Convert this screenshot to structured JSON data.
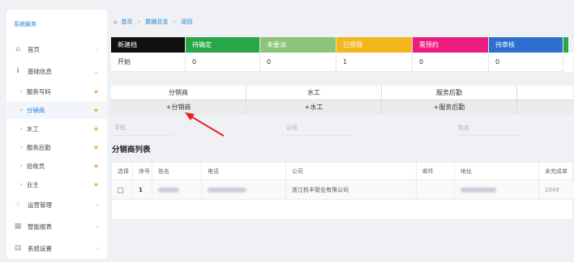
{
  "sidebar": {
    "title": "系统服务",
    "items": [
      {
        "icon": "home-icon",
        "label": "首页"
      },
      {
        "icon": "info-icon",
        "label": "基础信息"
      },
      {
        "icon": "hand-icon",
        "label": "运营管理"
      },
      {
        "icon": "table-icon",
        "label": "智能报表"
      },
      {
        "icon": "settings-icon",
        "label": "系统设置"
      }
    ],
    "sub_items": [
      {
        "label": "服务号码"
      },
      {
        "label": "分销商"
      },
      {
        "label": "水工"
      },
      {
        "label": "服务后勤"
      },
      {
        "label": "验收员"
      },
      {
        "label": "业主"
      }
    ]
  },
  "breadcrumb": {
    "home": "首页",
    "section": "数据总览",
    "back": "返回"
  },
  "status": {
    "headers": [
      "新建档",
      "待确定",
      "未委派",
      "已受理",
      "需预约",
      "待审核"
    ],
    "values": [
      "开始",
      "0",
      "0",
      "1",
      "0",
      "0"
    ],
    "colors": [
      "#111111",
      "#27a747",
      "#8cc47a",
      "#f1b71c",
      "#ea1d7e",
      "#2e6fd0",
      "#27a747"
    ]
  },
  "tabs": {
    "row1": [
      "分销商",
      "水工",
      "服务后勤"
    ],
    "row2": [
      "+分销商",
      "+水工",
      "+服务后勤"
    ]
  },
  "filters": {
    "phone": "手机",
    "company": "公司",
    "name": "姓名"
  },
  "list": {
    "title": "分销商列表",
    "columns": [
      "选择",
      "序号",
      "姓名",
      "电话",
      "公司",
      "邮件",
      "地址",
      "未完成单"
    ],
    "rows": [
      {
        "index": "1",
        "company": "浙江杭丰管业有限公司",
        "pending": "1049"
      }
    ]
  }
}
